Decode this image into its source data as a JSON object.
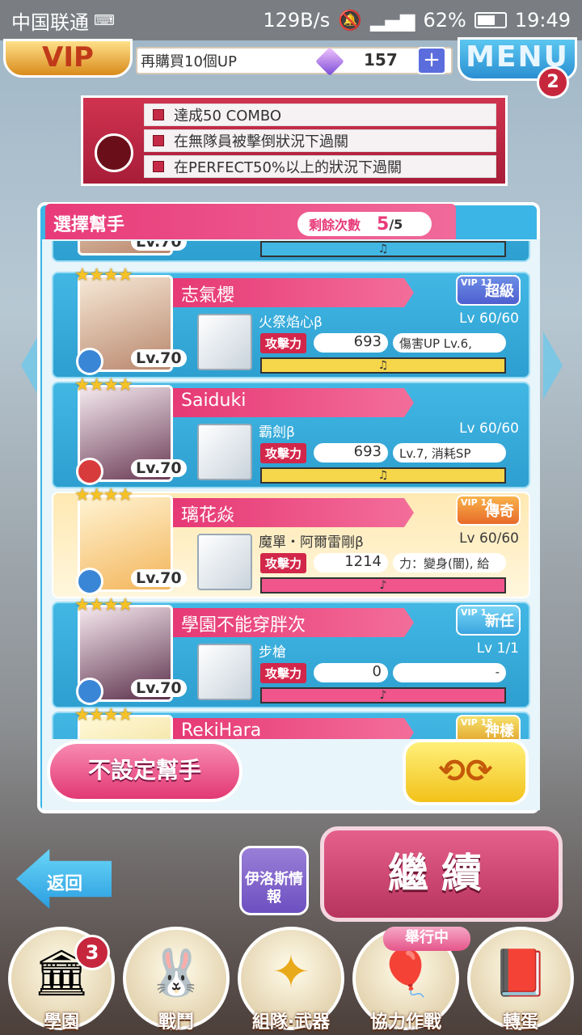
{
  "status": {
    "carrier": "中国联通",
    "speed": "129B/s",
    "battery": "62%",
    "time": "19:49"
  },
  "top": {
    "rebuy_text": "再購買10個UP",
    "gem_count": "157",
    "plus": "+",
    "menu": "MENU",
    "menu_badge": "2",
    "vip": "VIP"
  },
  "missions": [
    "達成50 COMBO",
    "在無隊員被擊倒狀況下過關",
    "在PERFECT50%以上的狀況下過關"
  ],
  "helper": {
    "title": "選擇幫手",
    "remaining_label": "剩餘次數",
    "remaining": "5",
    "remaining_total": "/5",
    "top_partial": {
      "lv": "Lv.70",
      "gauge": "♫"
    },
    "cards": [
      {
        "stars": "★★★★",
        "name": "志氣櫻",
        "lv": "Lv.70",
        "weapon": "火祭焰心β",
        "weapon_lv": "Lv 60/60",
        "atk_label": "攻擊力",
        "atk": "693",
        "skill": "傷害UP Lv.6,",
        "gauge": "♫",
        "vip_num": "VIP 11",
        "vip_title": "超級"
      },
      {
        "stars": "★★★★",
        "name": "Saiduki",
        "lv": "Lv.70",
        "weapon": "霸劍β",
        "weapon_lv": "Lv 60/60",
        "atk_label": "攻擊力",
        "atk": "693",
        "skill": "Lv.7, 消耗SP",
        "gauge": "♫"
      },
      {
        "stars": "★★★★",
        "name": "璃花焱",
        "lv": "Lv.70",
        "weapon": "魔單・阿爾雷剛β",
        "weapon_lv": "Lv 60/60",
        "atk_label": "攻擊力",
        "atk": "1214",
        "skill": "力：變身(闇), 給",
        "gauge": "♪",
        "vip_num": "VIP 14",
        "vip_title": "傳奇"
      },
      {
        "stars": "★★★★",
        "name": "學園不能穿胖次",
        "lv": "Lv.70",
        "weapon": "步槍",
        "weapon_lv": "Lv 1/1",
        "atk_label": "攻擊力",
        "atk": "0",
        "skill": "-",
        "gauge": "♪",
        "vip_num": "VIP 1",
        "vip_title": "新任"
      },
      {
        "stars": "★★★★",
        "name": "RekiHara",
        "vip_num": "VIP 15",
        "vip_title": "神樣"
      }
    ],
    "btn_no_helper": "不設定幫手",
    "btn_refresh": "⟲⟳"
  },
  "bottom": {
    "back": "返回",
    "info": "伊洛斯情報",
    "continue": "繼續",
    "event_tag": "舉行中",
    "nav": [
      {
        "label": "學園",
        "icon": "🏛",
        "badge": "3"
      },
      {
        "label": "戰鬥",
        "icon": "🐰"
      },
      {
        "label": "組隊·武器",
        "icon": "✦"
      },
      {
        "label": "協力作戰",
        "icon": "🎈"
      },
      {
        "label": "轉蛋",
        "icon": "📕"
      }
    ]
  },
  "colors": {
    "pink": "#e83a78",
    "cyan": "#3bb5e5",
    "gold": "#f6c224"
  }
}
